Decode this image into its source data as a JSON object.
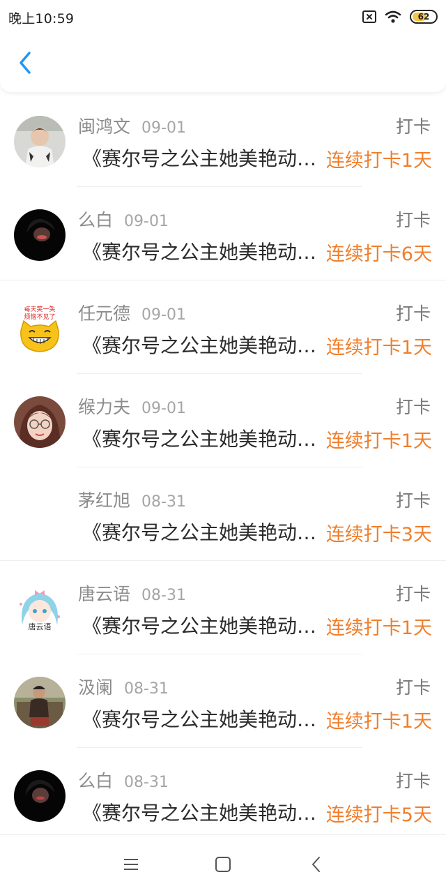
{
  "status": {
    "time": "晚上10:59",
    "battery": "62",
    "battery_level": 0.62
  },
  "header": {
    "back_icon": "chevron-left-icon",
    "accent": "#2196f3"
  },
  "colors": {
    "streak": "#f07e2c"
  },
  "records": [
    {
      "name": "闽鸿文",
      "date": "09-01",
      "type": "打卡",
      "title": "《赛尔号之公主她美艳动人》",
      "streak": "连续打卡1天"
    },
    {
      "name": "么白",
      "date": "09-01",
      "type": "打卡",
      "title": "《赛尔号之公主她美艳动人》",
      "streak": "连续打卡6天"
    },
    {
      "name": "任元德",
      "date": "09-01",
      "type": "打卡",
      "title": "《赛尔号之公主她美艳动人》",
      "streak": "连续打卡1天"
    },
    {
      "name": "缑力夫",
      "date": "09-01",
      "type": "打卡",
      "title": "《赛尔号之公主她美艳动人》",
      "streak": "连续打卡1天"
    },
    {
      "name": "茅红旭",
      "date": "08-31",
      "type": "打卡",
      "title": "《赛尔号之公主她美艳动人》",
      "streak": "连续打卡3天"
    },
    {
      "name": "唐云语",
      "date": "08-31",
      "type": "打卡",
      "title": "《赛尔号之公主她美艳动人》",
      "streak": "连续打卡1天"
    },
    {
      "name": "汲阑",
      "date": "08-31",
      "type": "打卡",
      "title": "《赛尔号之公主她美艳动人》",
      "streak": "连续打卡1天"
    },
    {
      "name": "么白",
      "date": "08-31",
      "type": "打卡",
      "title": "《赛尔号之公主她美艳动人》",
      "streak": "连续打卡5天"
    }
  ],
  "avatar_texts": {
    "ren_line1": "每天笑一笑",
    "ren_line2": "烦恼不见了",
    "tang": "唐云语"
  },
  "nav": {
    "menu_icon": "menu-icon",
    "home_icon": "home-square-icon",
    "back_icon": "back-triangle-icon"
  }
}
